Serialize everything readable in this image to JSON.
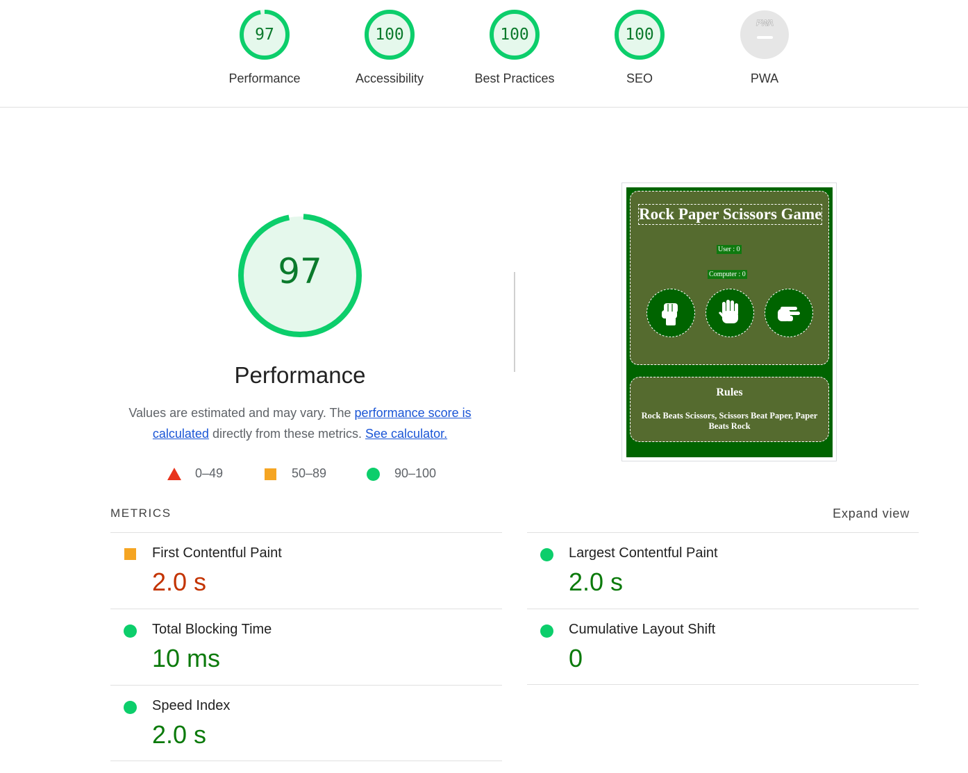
{
  "gauges": [
    {
      "score": "97",
      "label": "Performance",
      "fraction": 0.97
    },
    {
      "score": "100",
      "label": "Accessibility",
      "fraction": 1.0
    },
    {
      "score": "100",
      "label": "Best Practices",
      "fraction": 1.0
    },
    {
      "score": "100",
      "label": "SEO",
      "fraction": 1.0
    },
    {
      "score": "",
      "label": "PWA",
      "badge_text": "PWA"
    }
  ],
  "performance": {
    "score": "97",
    "score_fraction": 0.97,
    "title": "Performance",
    "desc_prefix": "Values are estimated and may vary. The ",
    "desc_link1": "performance score is calculated",
    "desc_middle": " directly from these metrics. ",
    "desc_link2": "See calculator.",
    "legend": [
      {
        "icon": "red-triangle-icon",
        "range": "0–49"
      },
      {
        "icon": "orange-square-icon",
        "range": "50–89"
      },
      {
        "icon": "green-circle-icon",
        "range": "90–100"
      }
    ]
  },
  "screenshot": {
    "title": "Rock Paper Scissors Game",
    "user_score": "User : 0",
    "computer_score": "Computer : 0",
    "choices": [
      "rock-fist-icon",
      "paper-hand-icon",
      "scissors-hand-icon"
    ],
    "rules_title": "Rules",
    "rules_text": "Rock Beats Scissors, Scissors Beat Paper, Paper Beats Rock"
  },
  "metrics": {
    "header": "METRICS",
    "expand": "Expand view",
    "items": [
      {
        "label": "First Contentful Paint",
        "value": "2.0 s",
        "status": "average"
      },
      {
        "label": "Largest Contentful Paint",
        "value": "2.0 s",
        "status": "pass"
      },
      {
        "label": "Total Blocking Time",
        "value": "10 ms",
        "status": "pass"
      },
      {
        "label": "Cumulative Layout Shift",
        "value": "0",
        "status": "pass"
      },
      {
        "label": "Speed Index",
        "value": "2.0 s",
        "status": "pass"
      }
    ]
  },
  "colors": {
    "pass": "#0cce6b",
    "pass_text": "#0b7a2c",
    "pass_fill": "#e5f8ec",
    "average": "#f5a523",
    "average_text": "#c33300",
    "fail": "#e8331c",
    "game_bg": "#006400",
    "game_panel": "#556b2f"
  }
}
